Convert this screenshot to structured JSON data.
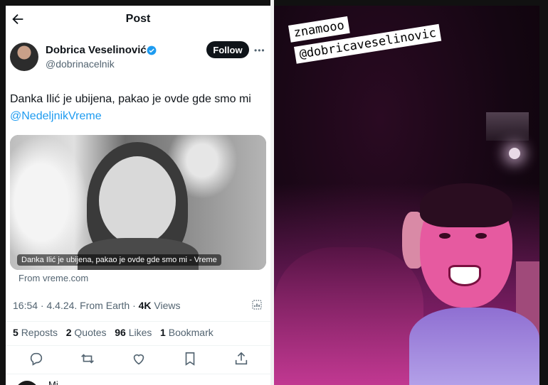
{
  "post": {
    "header_title": "Post",
    "author_name": "Dobrica Veselinović",
    "author_handle": "@dobrinacelnik",
    "follow_label": "Follow",
    "text": "Danka Ilić je ubijena, pakao je ovde gde smo mi",
    "mention": "@NedeljnikVreme",
    "card_caption": "Danka Ilić je ubijena, pakao je ovde gde smo mi - Vreme",
    "card_source": "From vreme.com",
    "meta_time": "16:54 · 4.4.24. From Earth · ",
    "meta_views_count": "4K",
    "meta_views_label": " Views",
    "reposts_count": "5",
    "reposts_label": "Reposts",
    "quotes_count": "2",
    "quotes_label": "Quotes",
    "likes_count": "96",
    "likes_label": "Likes",
    "bookmarks_count": "1",
    "bookmarks_label": "Bookmark",
    "reply_preview": "Mi"
  },
  "story": {
    "caption_line1": "znamooo",
    "caption_line2": "@dobricaveselinovic"
  },
  "colors": {
    "accent_blue": "#1d9bf0",
    "text_primary": "#0f1419",
    "text_secondary": "#536471"
  },
  "icons": [
    "back-arrow-icon",
    "verified-badge-icon",
    "more-icon",
    "analytics-icon",
    "reply-icon",
    "repost-icon",
    "like-icon",
    "bookmark-icon",
    "share-icon"
  ]
}
